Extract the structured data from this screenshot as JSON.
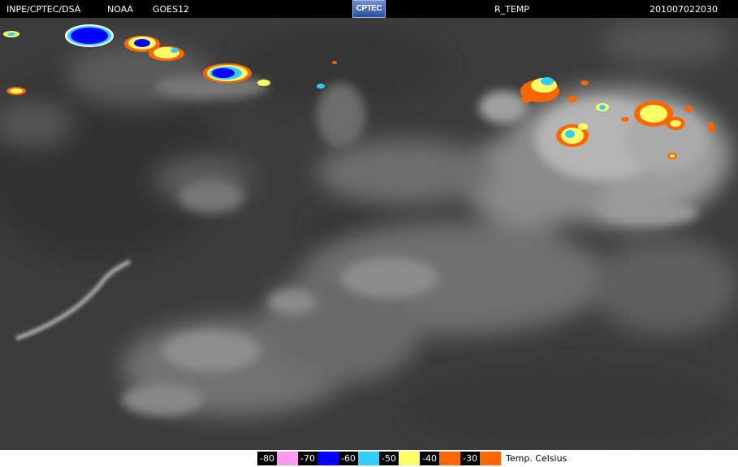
{
  "header": {
    "agency": "INPE/CPTEC/DSA",
    "provider": "NOAA",
    "satellite": "GOES12",
    "logo_text": "CPTEC",
    "product": "R_TEMP",
    "timestamp": "201007022030"
  },
  "legend": {
    "bins": [
      {
        "label": "-80",
        "color": "#ff99f0"
      },
      {
        "label": "-70",
        "color": "#0000ff"
      },
      {
        "label": "-60",
        "color": "#33ccff"
      },
      {
        "label": "-50",
        "color": "#ffff66"
      },
      {
        "label": "-40",
        "color": "#ff6600"
      },
      {
        "label": "-30",
        "color": ""
      }
    ],
    "unit": "Temp. Celsius"
  },
  "colors": {
    "background": "#3e3e3e",
    "cloud": "#9a9a9a",
    "bright_cloud": "#c8c8c8"
  }
}
